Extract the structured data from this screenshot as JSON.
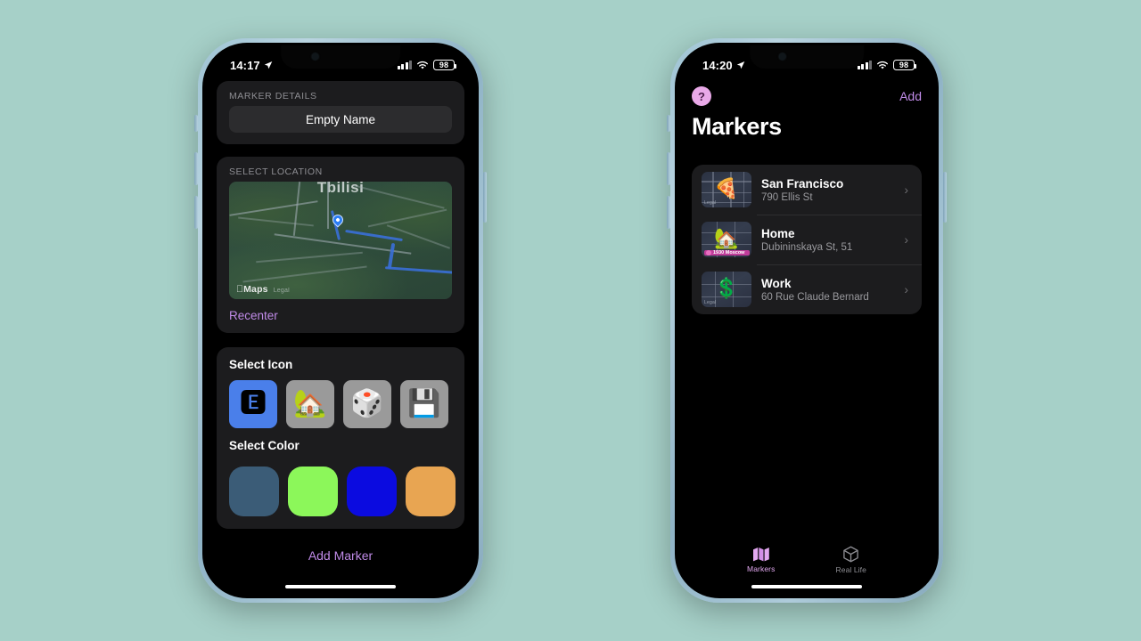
{
  "background_color": "#A6D0C8",
  "left_phone": {
    "status_bar": {
      "time": "14:17",
      "battery": "98",
      "location_icon": "location-arrow-icon",
      "wifi_icon": "wifi-icon",
      "signal_icon": "cellular-signal-icon"
    },
    "marker_details": {
      "section_label": "MARKER DETAILS",
      "name_field_value": "Empty Name",
      "name_field_placeholder": "Empty Name"
    },
    "select_location": {
      "section_label": "SELECT LOCATION",
      "map": {
        "city_label": "Tbilisi",
        "attribution": "Maps",
        "legal_link": "Legal",
        "pin": "map-pin"
      },
      "recenter_label": "Recenter"
    },
    "select_icon": {
      "title": "Select Icon",
      "options": [
        {
          "glyph": "🅴",
          "name": "letter-e-icon",
          "selected": true
        },
        {
          "glyph": "🏡",
          "name": "house-icon",
          "selected": false
        },
        {
          "glyph": "🎲",
          "name": "dice-icon",
          "selected": false
        },
        {
          "glyph": "💾",
          "name": "floppy-disk-icon",
          "selected": false
        }
      ],
      "selected_tile_color": "#4A7FEA",
      "tile_color": "#9A9A9A"
    },
    "select_color": {
      "title": "Select Color",
      "swatches": [
        "#3B5C77",
        "#8CF75A",
        "#0B0BE0",
        "#E8A552"
      ]
    },
    "add_marker_label": "Add Marker",
    "accent_color": "#C08BE8"
  },
  "right_phone": {
    "status_bar": {
      "time": "14:20",
      "battery": "98",
      "location_icon": "location-arrow-icon",
      "wifi_icon": "wifi-icon",
      "signal_icon": "cellular-signal-icon"
    },
    "nav": {
      "help_label": "?",
      "add_label": "Add"
    },
    "title": "Markers",
    "markers": [
      {
        "name": "San Francisco",
        "address": "790 Ellis St",
        "glyph": "🍕",
        "icon_name": "pizza-icon",
        "thumb_label": "Legal",
        "metro_label": ""
      },
      {
        "name": "Home",
        "address": "Dubininskaya St, 51",
        "glyph": "🏡",
        "icon_name": "house-icon",
        "thumb_label": "Legal",
        "metro_label": "1930 Moscow"
      },
      {
        "name": "Work",
        "address": "60 Rue Claude Bernard",
        "glyph": "💲",
        "icon_name": "dollar-icon",
        "thumb_label": "Legal",
        "metro_label": ""
      }
    ],
    "chevron": "›",
    "tabs": [
      {
        "label": "Markers",
        "icon": "folded-map-icon",
        "active": true
      },
      {
        "label": "Real Life",
        "icon": "cube-icon",
        "active": false
      }
    ],
    "accent_color": "#C08BE8",
    "active_tab_color": "#E2A8F0"
  }
}
